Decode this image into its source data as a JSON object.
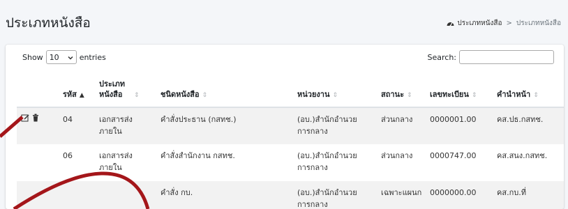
{
  "header": {
    "title": "ประเภทหนังสือ",
    "breadcrumb": {
      "home_icon": "tachometer-icon",
      "home_label": "ประเภทหนังสือ",
      "separator": ">",
      "current": "ประเภทหนังสือ"
    }
  },
  "table_controls": {
    "show_label": "Show",
    "page_length": "10",
    "entries_label": "entries",
    "search_label": "Search:",
    "search_value": ""
  },
  "table": {
    "columns": [
      {
        "label": "",
        "sort": "none"
      },
      {
        "label": "รหัส",
        "sort": "asc"
      },
      {
        "label": "ประเภทหนังสือ",
        "sort": "both"
      },
      {
        "label": "ชนิดหนังสือ",
        "sort": "both"
      },
      {
        "label": "หน่วยงาน",
        "sort": "both"
      },
      {
        "label": "สถานะ",
        "sort": "both"
      },
      {
        "label": "เลขทะเบียน",
        "sort": "both"
      },
      {
        "label": "คำนำหน้า",
        "sort": "both"
      }
    ],
    "rows": [
      {
        "code": "04",
        "book_type": "เอกสารส่งภายใน",
        "doc_kind": "คำสั่งประธาน (กสทช.)",
        "agency": "(อบ.)สำนักอำนวยการกลาง",
        "status": "ส่วนกลาง",
        "reg_no": "0000001.00",
        "prefix": "คส.ปธ.กสทช."
      },
      {
        "code": "06",
        "book_type": "เอกสารส่งภายใน",
        "doc_kind": "คำสั่งสำนักงาน กสทช.",
        "agency": "(อบ.)สำนักอำนวยการกลาง",
        "status": "ส่วนกลาง",
        "reg_no": "0000747.00",
        "prefix": "คส.สนง.กสทช."
      },
      {
        "code": "",
        "book_type": "",
        "doc_kind": "คำสั่ง กบ.",
        "agency": "(อบ.)สำนักอำนวยการกลาง",
        "status": "เฉพาะแผนก",
        "reg_no": "0000000.00",
        "prefix": "คส.กบ.ที่"
      }
    ],
    "actions": {
      "edit_icon": "edit-icon",
      "delete_icon": "trash-icon"
    }
  },
  "colors": {
    "annotation": "#a4161a",
    "striped_row": "#f2f2f2",
    "page_bg": "#f4f6f9"
  }
}
